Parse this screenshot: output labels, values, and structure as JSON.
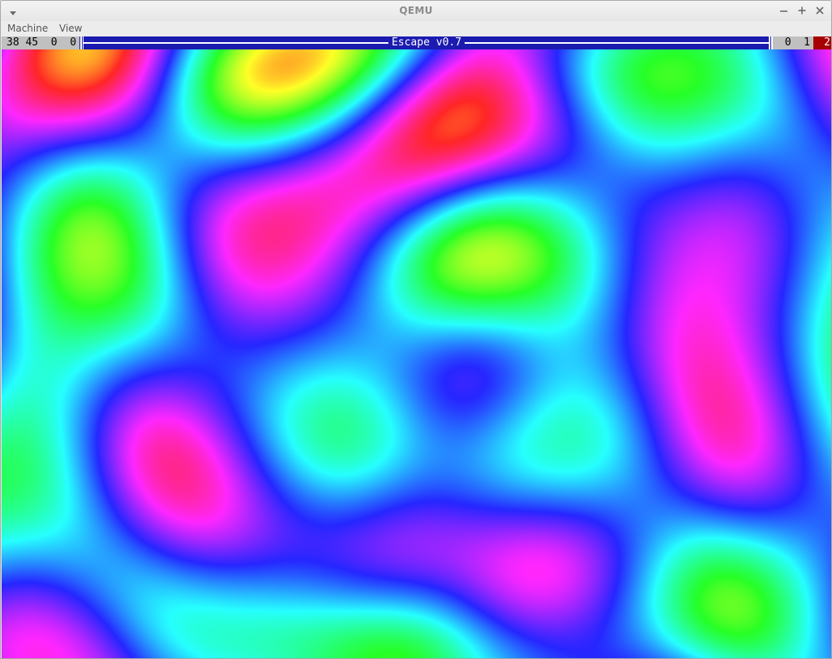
{
  "window": {
    "title": "QEMU"
  },
  "menubar": {
    "items": [
      {
        "label": "Machine"
      },
      {
        "label": "View"
      }
    ]
  },
  "guest": {
    "os_title": "Escape v0.7",
    "status_left": "38 45  0  0",
    "status_right": "0  1",
    "status_red": "2",
    "colors": {
      "status_bar": "#1b1bb0",
      "status_cell": "#c0c0c0",
      "status_alert": "#a80000"
    }
  },
  "icons": {
    "window_menu": "triangle-down-icon",
    "minimize": "minus-icon",
    "maximize": "plus-icon",
    "close": "x-icon"
  }
}
